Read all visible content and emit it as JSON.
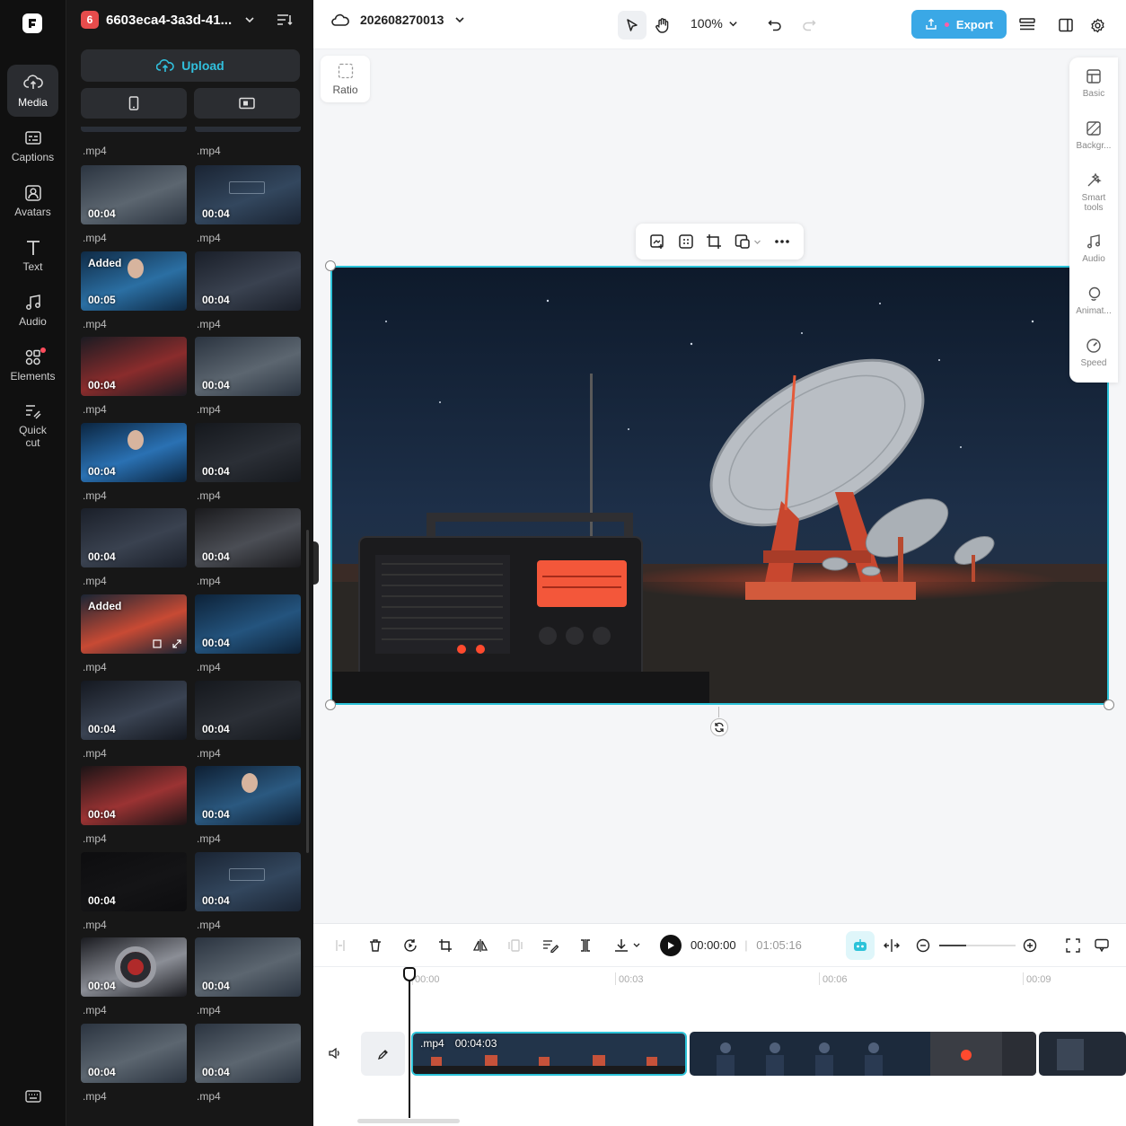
{
  "colors": {
    "accent": "#2cc3d9",
    "export_bg": "#3aa8e6",
    "panel_bg": "#171717",
    "rail_bg": "#101010"
  },
  "rail": {
    "items": [
      {
        "label": "Media",
        "icon": "cloud-media-icon"
      },
      {
        "label": "Captions",
        "icon": "captions-icon"
      },
      {
        "label": "Avatars",
        "icon": "avatar-icon"
      },
      {
        "label": "Text",
        "icon": "text-icon"
      },
      {
        "label": "Audio",
        "icon": "music-note-icon"
      },
      {
        "label": "Elements",
        "icon": "elements-icon"
      },
      {
        "label": "Quick cut",
        "icon": "quick-cut-icon"
      }
    ]
  },
  "panel": {
    "badge": "6",
    "title": "6603eca4-3a3d-41...",
    "upload_label": "Upload",
    "media": [
      {
        "duration": "00:04",
        "name": ".mp4",
        "added": "",
        "theme": "storm"
      },
      {
        "duration": "00:04",
        "name": ".mp4",
        "added": "",
        "theme": "clock"
      },
      {
        "duration": "00:05",
        "name": ".mp4",
        "added": "Added",
        "theme": "woman-cockpit"
      },
      {
        "duration": "00:04",
        "name": ".mp4",
        "added": "",
        "theme": "ships"
      },
      {
        "duration": "00:04",
        "name": ".mp4",
        "added": "",
        "theme": "red-tunnel"
      },
      {
        "duration": "00:04",
        "name": ".mp4",
        "added": "",
        "theme": "storm"
      },
      {
        "duration": "00:04",
        "name": ".mp4",
        "added": "",
        "theme": "portrait"
      },
      {
        "duration": "00:04",
        "name": ".mp4",
        "added": "",
        "theme": "dish"
      },
      {
        "duration": "00:04",
        "name": ".mp4",
        "added": "",
        "theme": "ships"
      },
      {
        "duration": "00:04",
        "name": ".mp4",
        "added": "",
        "theme": "portal"
      },
      {
        "duration": "",
        "name": ".mp4",
        "added": "Added",
        "theme": "radio"
      },
      {
        "duration": "00:04",
        "name": ".mp4",
        "added": "",
        "theme": "cockpit"
      },
      {
        "duration": "00:04",
        "name": ".mp4",
        "added": "",
        "theme": "console"
      },
      {
        "duration": "00:04",
        "name": ".mp4",
        "added": "",
        "theme": "dish"
      },
      {
        "duration": "00:04",
        "name": ".mp4",
        "added": "",
        "theme": "red-corridor"
      },
      {
        "duration": "00:04",
        "name": ".mp4",
        "added": "",
        "theme": "screen-woman"
      },
      {
        "duration": "00:04",
        "name": ".mp4",
        "added": "",
        "theme": "black"
      },
      {
        "duration": "00:04",
        "name": ".mp4",
        "added": "",
        "theme": "clock"
      },
      {
        "duration": "00:04",
        "name": ".mp4",
        "added": "",
        "theme": "vortex"
      },
      {
        "duration": "00:04",
        "name": ".mp4",
        "added": "",
        "theme": "storm"
      },
      {
        "duration": "00:04",
        "name": ".mp4",
        "added": "",
        "theme": "storm"
      },
      {
        "duration": "00:04",
        "name": ".mp4",
        "added": "",
        "theme": "storm"
      }
    ],
    "top_names": [
      ".mp4",
      ".mp4"
    ]
  },
  "topbar": {
    "project_name": "202608270013",
    "zoom": "100%",
    "export_label": "Export"
  },
  "canvas": {
    "ratio_label": "Ratio"
  },
  "right_tools": [
    {
      "label": "Basic",
      "icon": "basic-icon"
    },
    {
      "label": "Backgr...",
      "icon": "background-icon"
    },
    {
      "label": "Smart tools",
      "icon": "magic-wand-icon"
    },
    {
      "label": "Audio",
      "icon": "music-note-icon"
    },
    {
      "label": "Animat...",
      "icon": "animation-icon"
    },
    {
      "label": "Speed",
      "icon": "speed-icon"
    }
  ],
  "timeline": {
    "current_time": "00:00:00",
    "total_time": "01:05:16",
    "ruler": [
      "00:00",
      "00:03",
      "00:06",
      "00:09"
    ],
    "clip1": {
      "name": ".mp4",
      "duration": "00:04:03"
    }
  }
}
